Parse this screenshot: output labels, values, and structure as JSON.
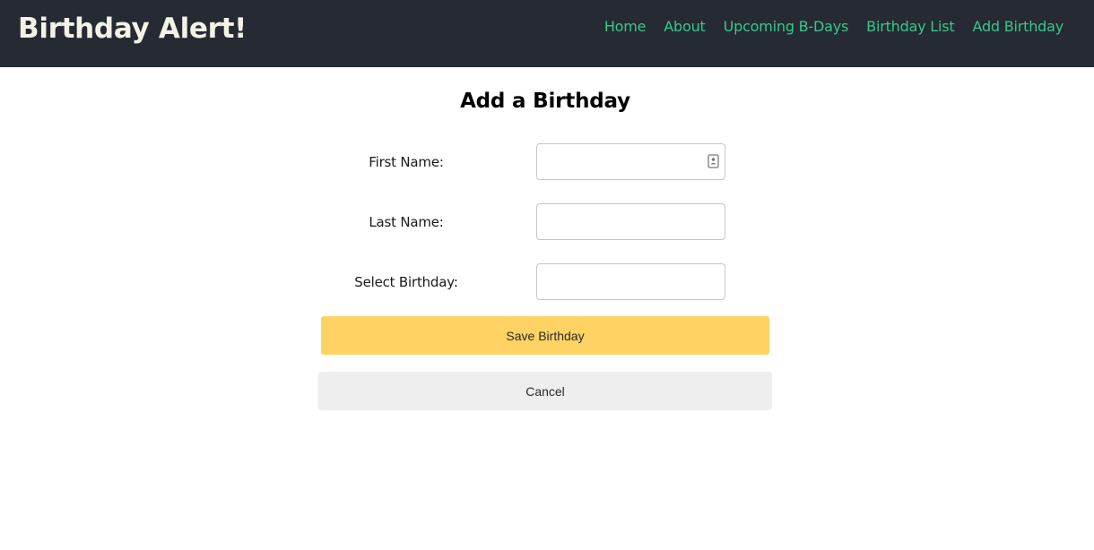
{
  "header": {
    "brand": "Birthday Alert!",
    "nav": [
      {
        "label": "Home"
      },
      {
        "label": "About"
      },
      {
        "label": "Upcoming B-Days"
      },
      {
        "label": "Birthday List"
      },
      {
        "label": "Add Birthday"
      }
    ]
  },
  "main": {
    "title": "Add a Birthday",
    "form": {
      "first_name": {
        "label": "First Name:",
        "value": "",
        "icon": "contact-card-icon"
      },
      "last_name": {
        "label": "Last Name:",
        "value": ""
      },
      "birthday": {
        "label": "Select Birthday:",
        "value": ""
      }
    },
    "save_label": "Save Birthday",
    "cancel_label": "Cancel"
  },
  "colors": {
    "navbar_bg": "#262a33",
    "brand": "#f2f2e6",
    "nav_link": "#35c98a",
    "save_button": "#ffd264",
    "cancel_button": "#eeeeee"
  }
}
